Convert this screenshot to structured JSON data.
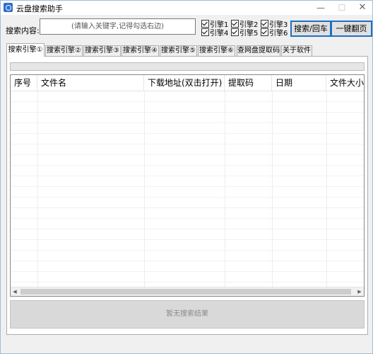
{
  "window": {
    "title": "云盘搜索助手",
    "minimize_glyph": "—",
    "maximize_glyph": "☐",
    "close_glyph": "✕"
  },
  "search": {
    "label": "搜索内容:",
    "value": "(请输入关键字,记得勾选右边)"
  },
  "engines": [
    {
      "label": "引擎1",
      "checked": true
    },
    {
      "label": "引擎2",
      "checked": true
    },
    {
      "label": "引擎3",
      "checked": true
    },
    {
      "label": "引擎4",
      "checked": true
    },
    {
      "label": "引擎5",
      "checked": true
    },
    {
      "label": "引擎6",
      "checked": true
    }
  ],
  "buttons": {
    "search": "搜索/回车",
    "next_page": "一键翻页"
  },
  "tabs": [
    {
      "label": "搜索引擎①",
      "active": true
    },
    {
      "label": "搜索引擎②"
    },
    {
      "label": "搜索引擎③"
    },
    {
      "label": "搜索引擎④"
    },
    {
      "label": "搜索引擎⑤"
    },
    {
      "label": "搜索引擎⑥"
    },
    {
      "label": "查网盘提取码"
    },
    {
      "label": "关于软件"
    }
  ],
  "progress": {
    "value": 0
  },
  "table": {
    "columns": [
      "序号",
      "文件名",
      "下载地址(双击打开)",
      "提取码",
      "日期",
      "文件大小"
    ],
    "rows": []
  },
  "status": {
    "empty_result": "暂无搜索结果"
  },
  "colors": {
    "accent_border": "#1e6fc4",
    "progress_fill": "#06b025"
  }
}
